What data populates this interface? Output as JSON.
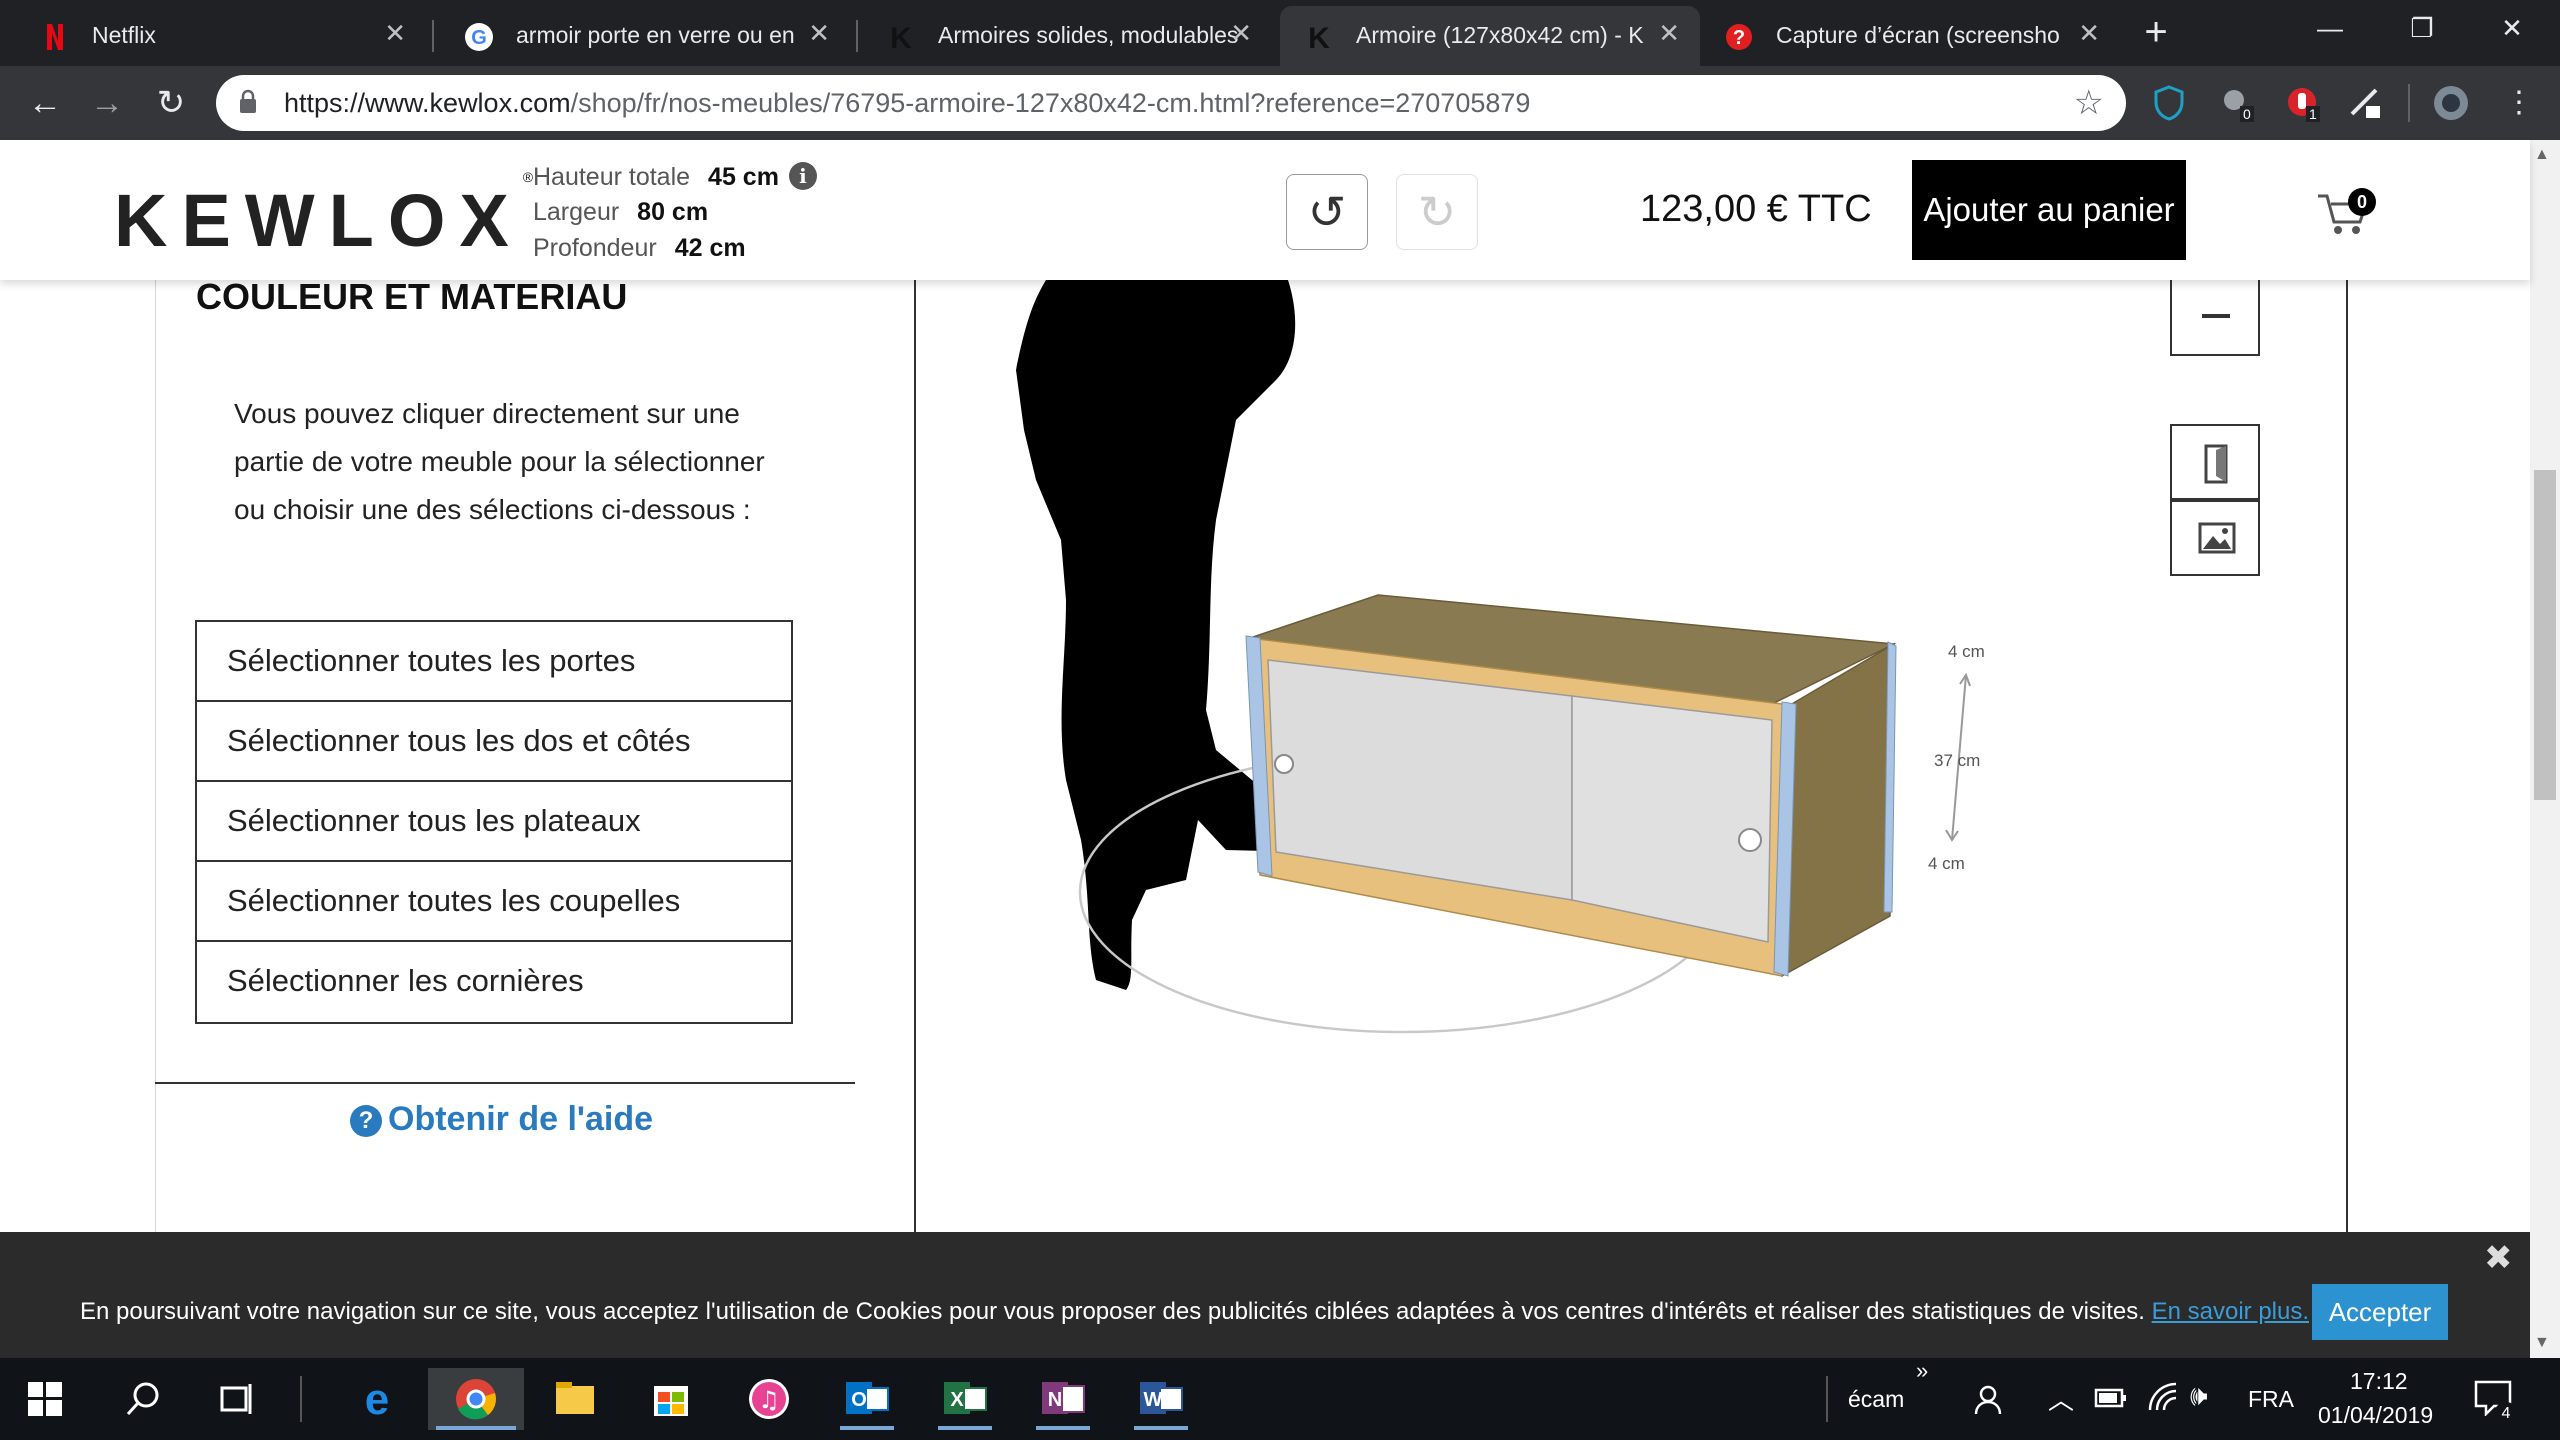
{
  "browser": {
    "tabs": [
      {
        "title": "Netflix",
        "favicon": "netflix-logo"
      },
      {
        "title": "armoir porte en verre ou en",
        "favicon": "google-logo"
      },
      {
        "title": "Armoires solides, modulables",
        "favicon": "kewlox-k-logo"
      },
      {
        "title": "Armoire (127x80x42 cm) - K",
        "favicon": "kewlox-k-logo",
        "active": true
      },
      {
        "title": "Capture d’écran (screensho",
        "favicon": "help-question-icon"
      }
    ],
    "url_host": "https://www.kewlox.com",
    "url_path": "/shop/fr/nos-meubles/76795-armoire-127x80x42-cm.html?reference=270705879",
    "ext_badges": [
      "0",
      "1"
    ]
  },
  "header": {
    "logo": "KEWLOX",
    "logo_mark": "®",
    "dims": [
      {
        "label": "Hauteur totale",
        "value": "45 cm"
      },
      {
        "label": "Largeur",
        "value": "80 cm"
      },
      {
        "label": "Profondeur",
        "value": "42 cm"
      }
    ],
    "price": "123,00 € TTC",
    "add_to_cart": "Ajouter au panier",
    "cart_count": "0"
  },
  "panel": {
    "title": "COULEUR ET MATERIAU",
    "intro": "Vous pouvez cliquer directement sur une partie de votre meuble pour la sélectionner ou choisir une des sélections ci-dessous :",
    "selections": [
      "Sélectionner toutes les portes",
      "Sélectionner tous les dos et côtés",
      "Sélectionner tous les plateaux",
      "Sélectionner toutes les coupelles",
      "Sélectionner les cornières"
    ],
    "help": "Obtenir de l'aide"
  },
  "viewer": {
    "dim_top": "4 cm",
    "dim_middle": "37 cm",
    "dim_bottom": "4 cm",
    "colors": {
      "frame_wood": "#e8c07e",
      "top_panel": "#8a7a52",
      "corner_posts": "#a9c4e4",
      "doors": "#dcdcdc"
    }
  },
  "cookie": {
    "text": "En poursuivant votre navigation sur ce site, vous acceptez l'utilisation de Cookies pour vous proposer des publicités ciblées adaptées à vos centres d'intérêts et réaliser des statistiques de visites.",
    "link": "En savoir plus.",
    "accept": "Accepter"
  },
  "taskbar": {
    "search_label": "écam",
    "chevron": "»",
    "language": "FRA",
    "time": "17:12",
    "date": "01/04/2019",
    "notification_count": "4"
  }
}
